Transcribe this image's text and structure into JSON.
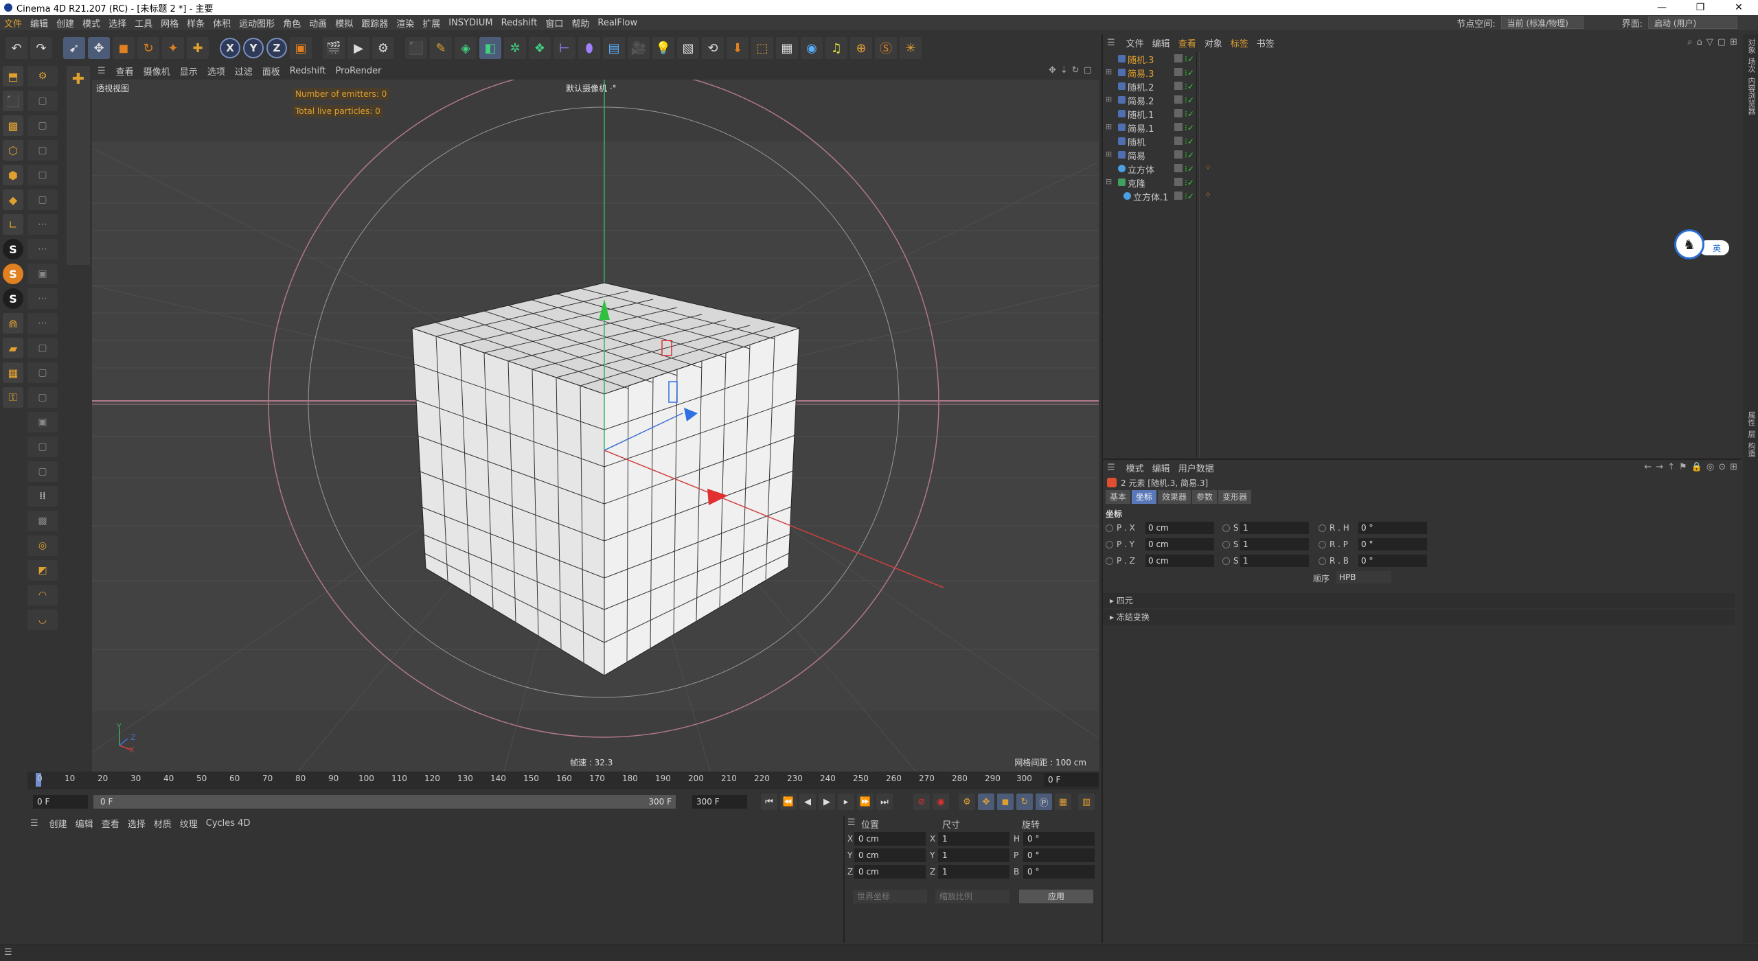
{
  "window": {
    "title": "Cinema 4D R21.207 (RC) - [未标题 2 *] - 主要",
    "controls": [
      "—",
      "❐",
      "✕"
    ]
  },
  "menubar": {
    "items": [
      "文件",
      "编辑",
      "创建",
      "模式",
      "选择",
      "工具",
      "网格",
      "样条",
      "体积",
      "运动图形",
      "角色",
      "动画",
      "模拟",
      "跟踪器",
      "渲染",
      "扩展",
      "INSYDIUM",
      "Redshift",
      "窗口",
      "帮助",
      "RealFlow"
    ],
    "node_space_label": "节点空间:",
    "node_space_value": "当前 (标准/物理)",
    "interface_label": "界面:",
    "interface_value": "启动 (用户)"
  },
  "toolbar": {
    "axis_x": "X",
    "axis_y": "Y",
    "axis_z": "Z"
  },
  "viewport": {
    "menu": [
      "查看",
      "摄像机",
      "显示",
      "选项",
      "过滤",
      "面板",
      "Redshift",
      "ProRender"
    ],
    "label": "透视视图",
    "camera": "默认摄像机 ·°",
    "hud_emitters": "Number of emitters: 0",
    "hud_particles": "Total live particles: 0",
    "fps": "帧速 : 32.3",
    "grid_spacing": "网格间距 : 100 cm",
    "axis_y": "Y",
    "axis_z": "Z",
    "axis_x": "X"
  },
  "timeline": {
    "ticks": [
      "0",
      "10",
      "20",
      "30",
      "40",
      "50",
      "60",
      "70",
      "80",
      "90",
      "100",
      "110",
      "120",
      "130",
      "140",
      "150",
      "160",
      "170",
      "180",
      "190",
      "200",
      "210",
      "220",
      "230",
      "240",
      "250",
      "260",
      "270",
      "280",
      "290",
      "300"
    ],
    "current_frame": "0 F",
    "start_field": "0 F",
    "range_start": "0 F",
    "range_end": "300 F",
    "end_field": "300 F"
  },
  "material_panel": {
    "menu": [
      "创建",
      "编辑",
      "查看",
      "选择",
      "材质",
      "纹理",
      "Cycles 4D"
    ]
  },
  "coord_panel": {
    "headers": [
      "位置",
      "尺寸",
      "旋转"
    ],
    "rows": [
      {
        "axis": "X",
        "pos": "0 cm",
        "size_axis": "X",
        "size": "1",
        "rot_axis": "H",
        "rot": "0 °"
      },
      {
        "axis": "Y",
        "pos": "0 cm",
        "size_axis": "Y",
        "size": "1",
        "rot_axis": "P",
        "rot": "0 °"
      },
      {
        "axis": "Z",
        "pos": "0 cm",
        "size_axis": "Z",
        "size": "1",
        "rot_axis": "B",
        "rot": "0 °"
      }
    ],
    "world_dropdown": "世界坐标",
    "scale_dropdown": "缩放比例",
    "apply_button": "应用"
  },
  "object_panel": {
    "menu": [
      "文件",
      "编辑",
      "查看",
      "对象",
      "标签",
      "书签"
    ],
    "active_menu": "查看",
    "objects": [
      {
        "name": "随机.3",
        "selected": true,
        "tag": false
      },
      {
        "name": "简易.3",
        "selected": true,
        "tag": false
      },
      {
        "name": "随机.2",
        "selected": false,
        "tag": false
      },
      {
        "name": "简易.2",
        "selected": false,
        "tag": false
      },
      {
        "name": "随机.1",
        "selected": false,
        "tag": false
      },
      {
        "name": "简易.1",
        "selected": false,
        "tag": false
      },
      {
        "name": "随机",
        "selected": false,
        "tag": false
      },
      {
        "name": "简易",
        "selected": false,
        "tag": false
      },
      {
        "name": "立方体",
        "selected": false,
        "tag": true
      },
      {
        "name": "克隆",
        "selected": false,
        "tag": false
      },
      {
        "name": "立方体.1",
        "selected": false,
        "tag": true
      }
    ],
    "ime_label": "英"
  },
  "attribute_panel": {
    "menu": [
      "模式",
      "编辑",
      "用户数据"
    ],
    "selection_info": "2 元素 [随机.3, 简易.3]",
    "tabs": [
      "基本",
      "坐标",
      "效果器",
      "参数",
      "变形器"
    ],
    "active_tab": "坐标",
    "section_title": "坐标",
    "rows": [
      {
        "p_label": "P . X",
        "p_val": "0 cm",
        "s_label": "S . X",
        "s_val": "1",
        "r_label": "R . H",
        "r_val": "0 °"
      },
      {
        "p_label": "P . Y",
        "p_val": "0 cm",
        "s_label": "S . Y",
        "s_val": "1",
        "r_label": "R . P",
        "r_val": "0 °"
      },
      {
        "p_label": "P . Z",
        "p_val": "0 cm",
        "s_label": "S . Z",
        "s_val": "1",
        "r_label": "R . B",
        "r_val": "0 °"
      }
    ],
    "order_label": "顺序",
    "order_value": "HPB",
    "collapsibles": [
      "四元",
      "冻结变换"
    ]
  },
  "right_strip": [
    "对象",
    "场次",
    "内容浏览器",
    "属性",
    "层",
    "构造"
  ],
  "statusbar": {
    "icon": "☰"
  },
  "colors": {
    "accent": "#e0a030",
    "tab_active": "#5a78b8",
    "check_green": "#30d030"
  }
}
